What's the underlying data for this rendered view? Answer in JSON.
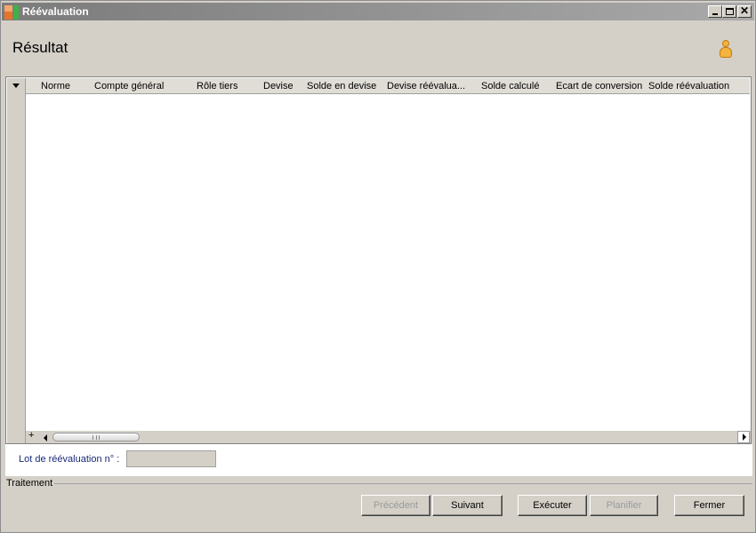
{
  "window": {
    "title": "Réévaluation",
    "controls": {
      "minimize": "_",
      "maximize": "□",
      "close": "✕"
    }
  },
  "header": {
    "page_title": "Résultat",
    "user_icon": "user-icon"
  },
  "grid": {
    "columns": [
      "Norme",
      "Compte général",
      "Rôle tiers",
      "Devise",
      "Solde en devise",
      "Devise réévalua...",
      "Solde calculé",
      "Ecart de conversion",
      "Solde réévaluation"
    ],
    "rows": [],
    "expand_symbol": "+"
  },
  "lot": {
    "label": "Lot de réévaluation n° :",
    "value": ""
  },
  "traitement": {
    "label": "Traitement"
  },
  "buttons": {
    "previous": "Précédent",
    "next": "Suivant",
    "execute": "Exécuter",
    "schedule": "Planifier",
    "close": "Fermer"
  },
  "colors": {
    "window_bg": "#d4d0c8",
    "titlebar": "#8a8a8a",
    "lot_label": "#1a2a7a",
    "disabled_text": "#9a9a9a"
  }
}
